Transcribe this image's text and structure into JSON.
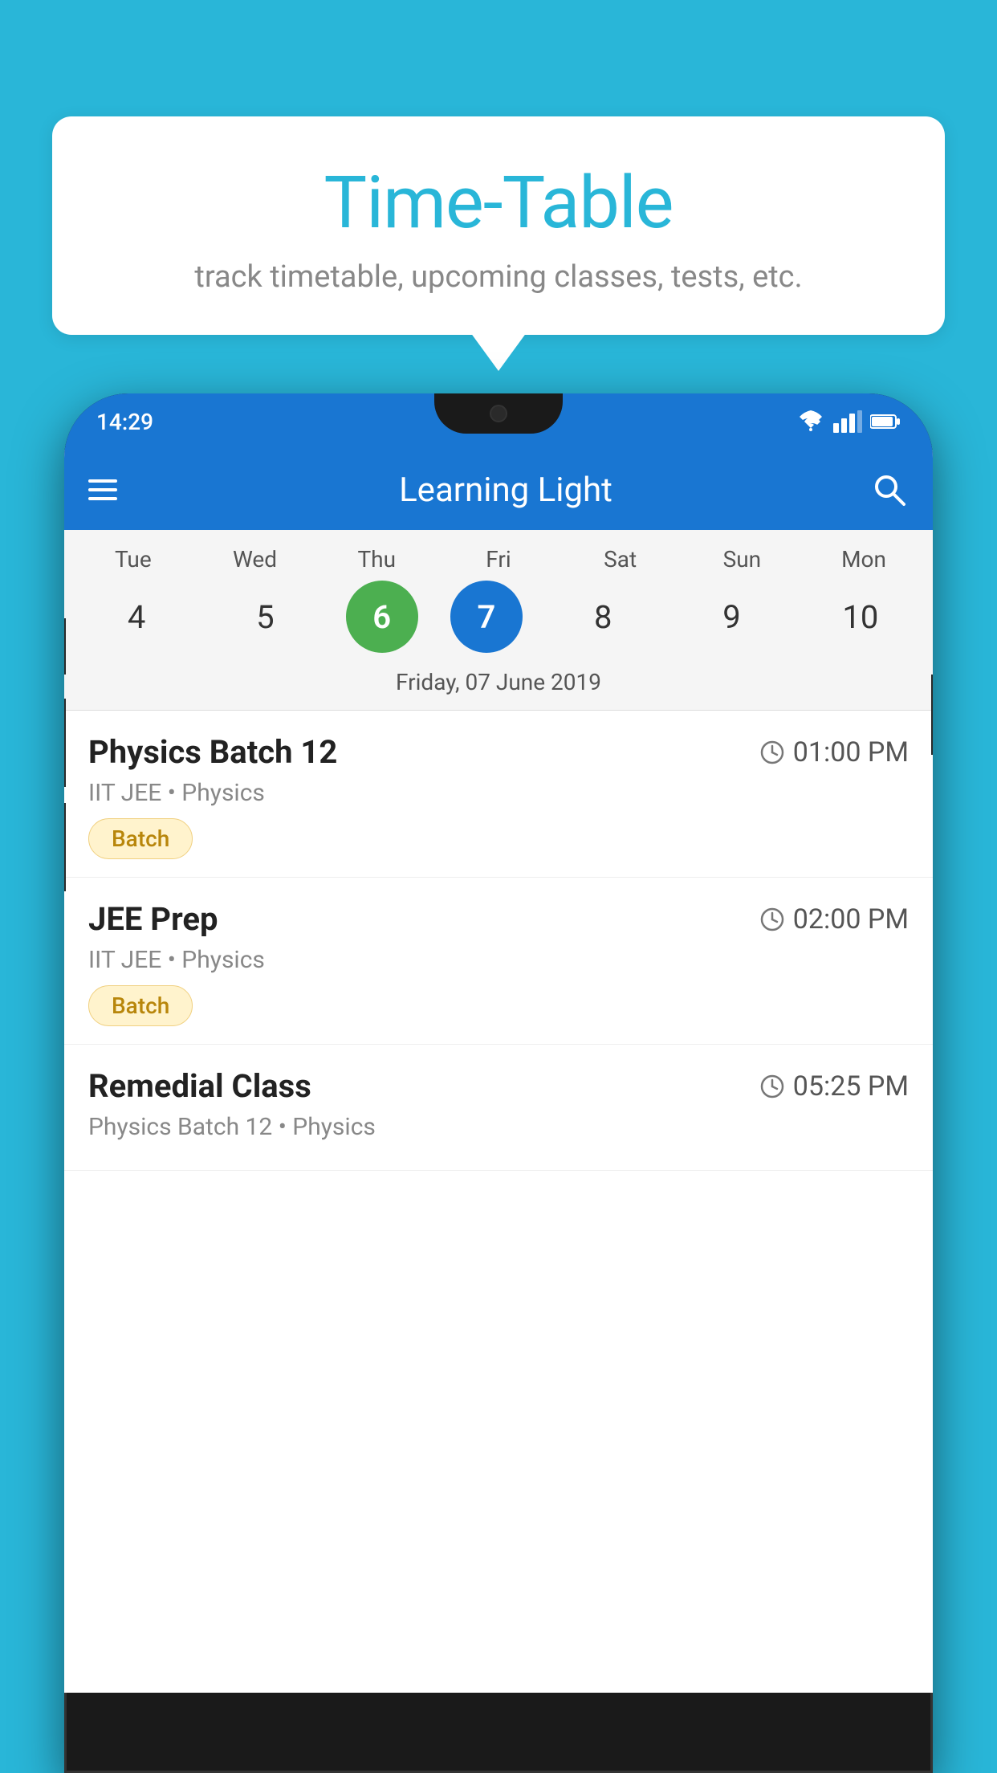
{
  "background_color": "#29b6d8",
  "bubble": {
    "title": "Time-Table",
    "subtitle": "track timetable, upcoming classes, tests, etc."
  },
  "app": {
    "toolbar": {
      "title": "Learning Light"
    },
    "status_bar": {
      "time": "14:29"
    },
    "calendar": {
      "days": [
        {
          "label": "Tue",
          "num": "4"
        },
        {
          "label": "Wed",
          "num": "5"
        },
        {
          "label": "Thu",
          "num": "6",
          "state": "today"
        },
        {
          "label": "Fri",
          "num": "7",
          "state": "selected"
        },
        {
          "label": "Sat",
          "num": "8"
        },
        {
          "label": "Sun",
          "num": "9"
        },
        {
          "label": "Mon",
          "num": "10"
        }
      ],
      "selected_date": "Friday, 07 June 2019"
    },
    "schedule": [
      {
        "title": "Physics Batch 12",
        "time": "01:00 PM",
        "meta": "IIT JEE • Physics",
        "badge": "Batch"
      },
      {
        "title": "JEE Prep",
        "time": "02:00 PM",
        "meta": "IIT JEE • Physics",
        "badge": "Batch"
      },
      {
        "title": "Remedial Class",
        "time": "05:25 PM",
        "meta": "Physics Batch 12 • Physics",
        "badge": ""
      }
    ]
  }
}
